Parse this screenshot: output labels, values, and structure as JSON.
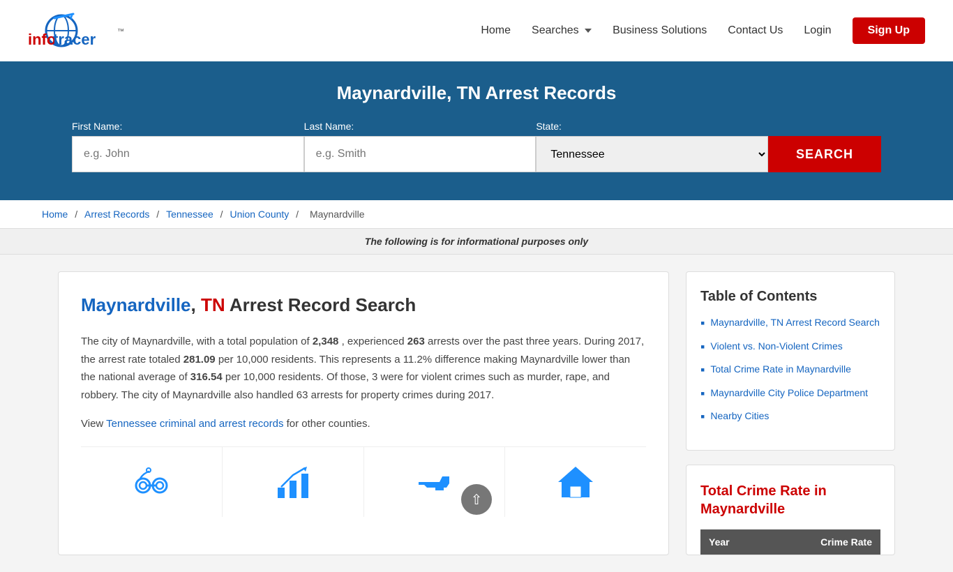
{
  "brand": {
    "name_info": "info",
    "name_tracer": "tracer",
    "tagline": "™"
  },
  "nav": {
    "home_label": "Home",
    "searches_label": "Searches",
    "business_label": "Business Solutions",
    "contact_label": "Contact Us",
    "login_label": "Login",
    "signup_label": "Sign Up"
  },
  "hero": {
    "title": "Maynardville, TN Arrest Records",
    "first_name_label": "First Name:",
    "first_name_placeholder": "e.g. John",
    "last_name_label": "Last Name:",
    "last_name_placeholder": "e.g. Smith",
    "state_label": "State:",
    "state_value": "Tennessee",
    "search_btn": "SEARCH"
  },
  "breadcrumb": {
    "home": "Home",
    "arrest_records": "Arrest Records",
    "tennessee": "Tennessee",
    "union_county": "Union County",
    "maynardville": "Maynardville"
  },
  "info_bar": {
    "text": "The following is for informational purposes only"
  },
  "article": {
    "title_city": "Maynardville",
    "title_comma": ",",
    "title_state": " TN ",
    "title_rest": "Arrest Record Search",
    "body": "The city of Maynardville, with a total population of",
    "population": "2,348",
    "body2": ", experienced",
    "arrests": "263",
    "body3": "arrests over the past three years. During 2017, the arrest rate totaled",
    "arrest_rate": "281.09",
    "body4": "per 10,000 residents. This represents a 11.2% difference making Maynardville lower than the national average of",
    "national_avg": "316.54",
    "body5": "per 10,000 residents. Of those, 3 were for violent crimes such as murder, rape, and robbery. The city of Maynardville also handled 63 arrests for property crimes during 2017.",
    "view_link_pre": "View",
    "view_link_text": "Tennessee criminal and arrest records",
    "view_link_post": "for other counties."
  },
  "icons": [
    {
      "name": "handcuffs-icon",
      "label": ""
    },
    {
      "name": "chart-icon",
      "label": ""
    },
    {
      "name": "gun-icon",
      "label": ""
    },
    {
      "name": "house-icon",
      "label": ""
    }
  ],
  "toc": {
    "title": "Table of Contents",
    "items": [
      {
        "label": "Maynardville, TN Arrest Record Search",
        "href": "#"
      },
      {
        "label": "Violent vs. Non-Violent Crimes",
        "href": "#"
      },
      {
        "label": "Total Crime Rate in Maynardville",
        "href": "#"
      },
      {
        "label": "Maynardville City Police Department",
        "href": "#"
      },
      {
        "label": "Nearby Cities",
        "href": "#"
      }
    ]
  },
  "crime_rate": {
    "title": "Total Crime Rate in Maynardville",
    "col_year": "Year",
    "col_rate": "Crime Rate"
  }
}
